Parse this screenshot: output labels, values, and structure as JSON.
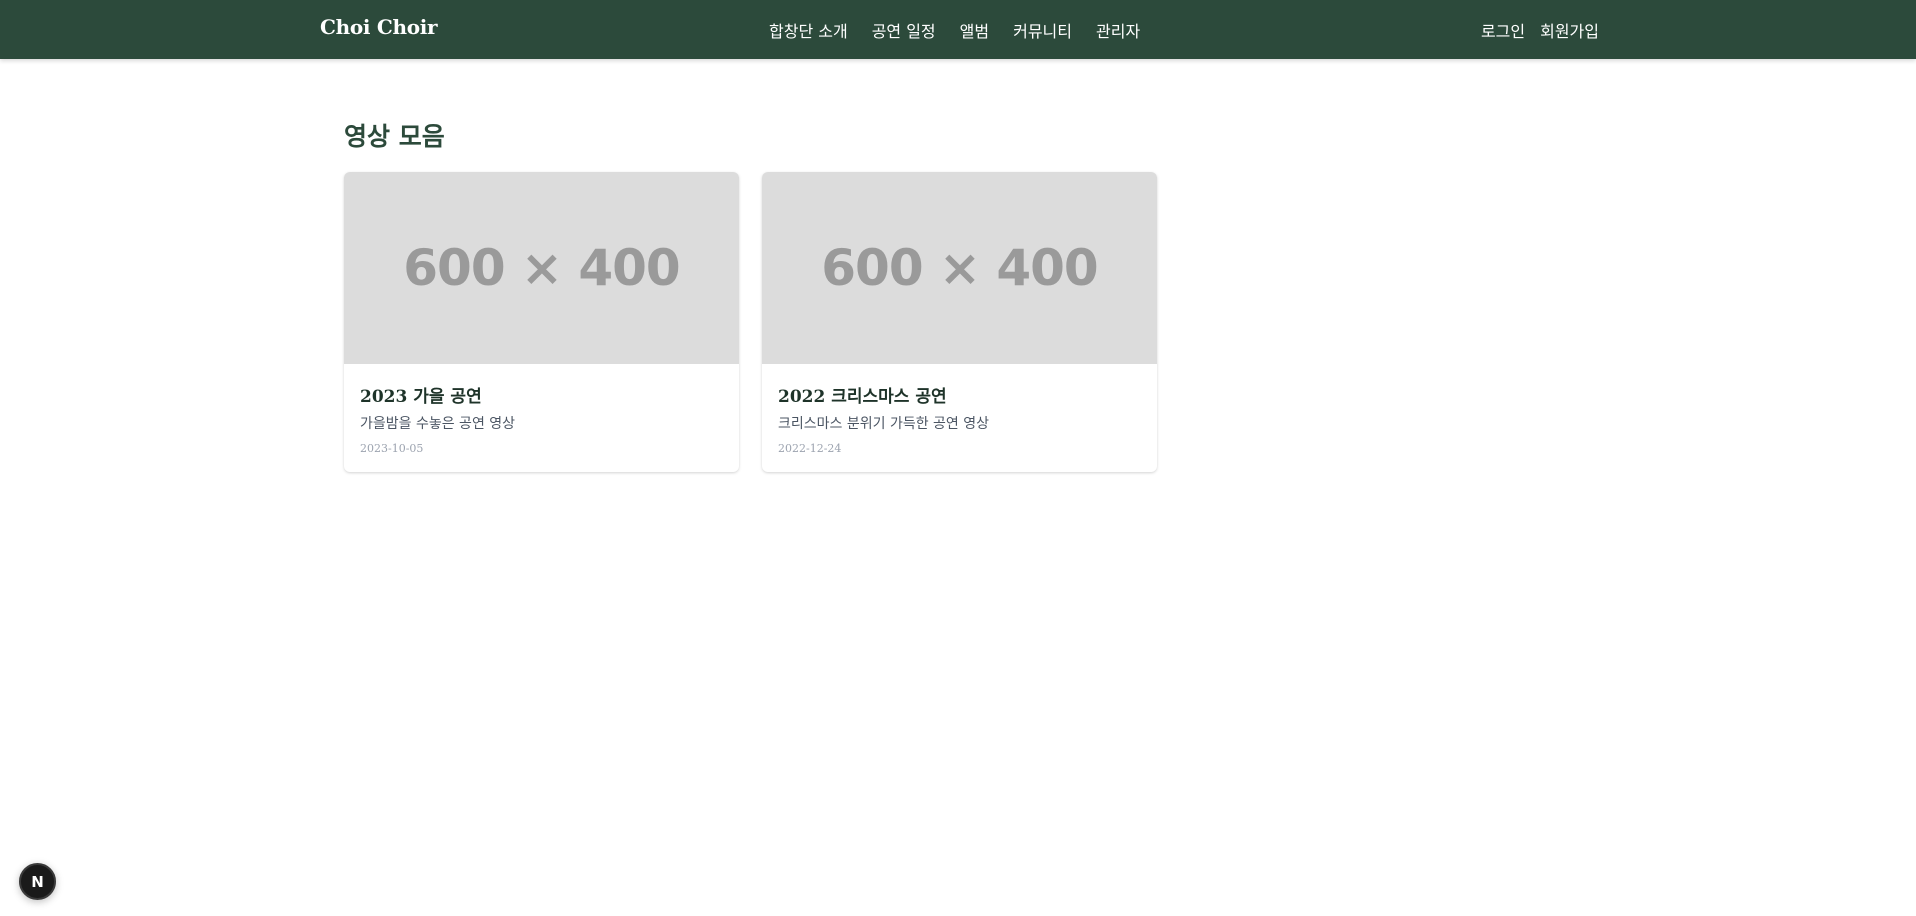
{
  "navbar": {
    "brand": "Choi Choir",
    "links": [
      "합창단 소개",
      "공연 일정",
      "앨범",
      "커뮤니티",
      "관리자"
    ],
    "auth": {
      "login": "로그인",
      "signup": "회원가입"
    }
  },
  "page": {
    "title": "영상 모음"
  },
  "videos": [
    {
      "placeholder": "600 × 400",
      "title": "2023 가을 공연",
      "description": "가을밤을 수놓은 공연 영상",
      "date": "2023-10-05"
    },
    {
      "placeholder": "600 × 400",
      "title": "2022 크리스마스 공연",
      "description": "크리스마스 분위기 가득한 공연 영상",
      "date": "2022-12-24"
    }
  ],
  "dev_indicator": {
    "label": "N"
  },
  "colors": {
    "navbar": "#2c4a3b",
    "title": "#2c4a3b",
    "thumbnail": "#dcdcdc"
  }
}
